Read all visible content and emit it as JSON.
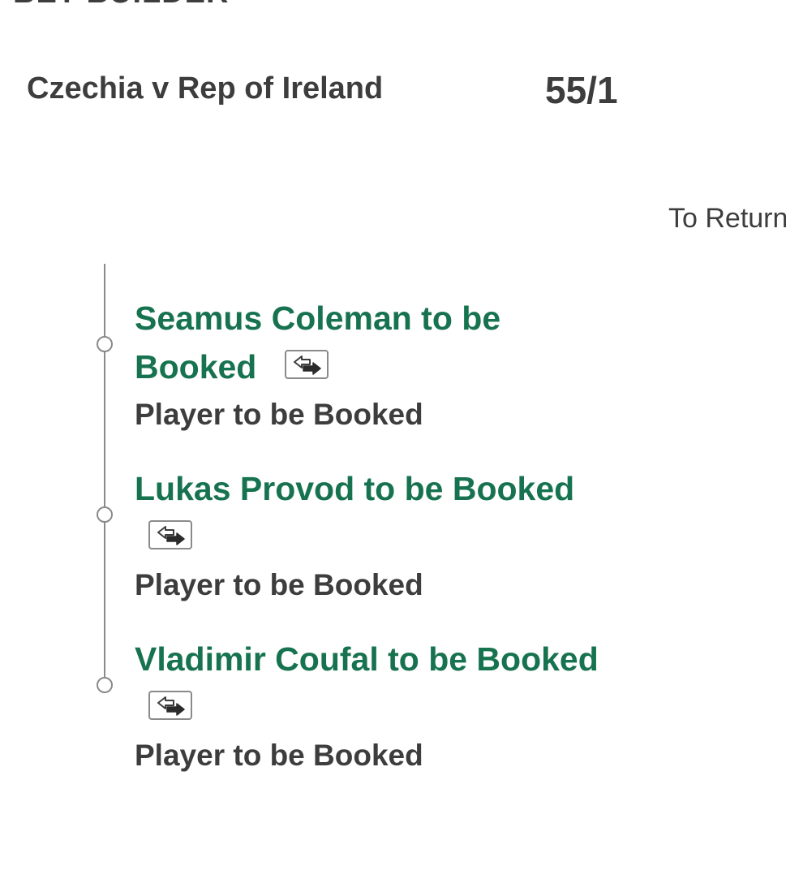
{
  "header": {
    "title": "BET BUILDER"
  },
  "event": {
    "match": "Czechia v Rep of Ireland",
    "odds": "55/1",
    "to_return_label": "To Return"
  },
  "selections": [
    {
      "title_line1": "Seamus Coleman to be",
      "title_line2": "Booked",
      "market": "Player to be Booked",
      "swap_icon": "swap-icon"
    },
    {
      "title_line1": "Lukas Provod to be Booked",
      "market": "Player to be Booked",
      "swap_icon": "swap-icon"
    },
    {
      "title_line1": "Vladimir Coufal to be Booked",
      "market": "Player to be Booked",
      "swap_icon": "swap-icon"
    }
  ],
  "colors": {
    "selection_green": "#17734f",
    "text_dark": "#3d3d3d",
    "timeline_gray": "#8a8a8a"
  }
}
